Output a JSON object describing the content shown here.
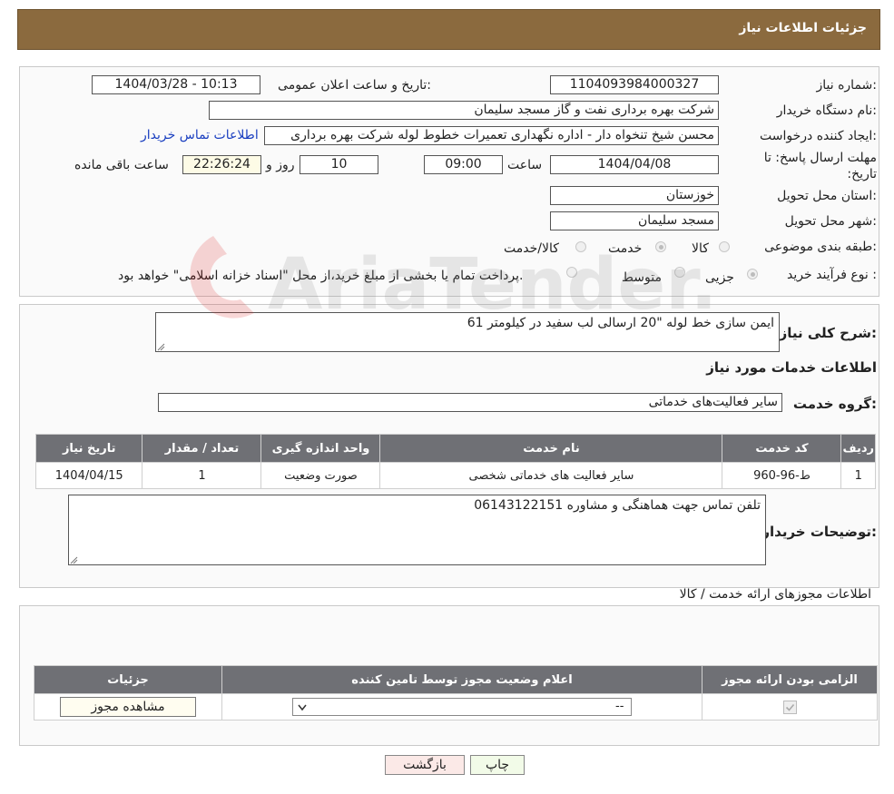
{
  "header": {
    "title": "جزئیات اطلاعات نیاز"
  },
  "form": {
    "need_number_label": "شماره نیاز:",
    "need_number": "1104093984000327",
    "announce_label": "تاریخ و ساعت اعلان عمومی:",
    "announce_value": "1404/03/28 - 10:13",
    "buyer_org_label": "نام دستگاه خریدار:",
    "buyer_org": "شرکت بهره برداری نفت و گاز مسجد سلیمان",
    "creator_label": "ایجاد کننده درخواست:",
    "creator": "محسن شیخ تنخواه دار - اداره نگهداری تعمیرات خطوط لوله  شرکت بهره برداری",
    "buyer_contact_link": "اطلاعات تماس خریدار",
    "deadline_label": "مهلت ارسال پاسخ: تا تاریخ:",
    "deadline_date": "1404/04/08",
    "time_label": "ساعت",
    "deadline_time": "09:00",
    "days_value": "10",
    "days_label": "روز و",
    "remaining_time": "22:26:24",
    "remaining_label": "ساعت باقی مانده",
    "province_label": "استان محل تحویل:",
    "province": "خوزستان",
    "city_label": "شهر محل تحویل:",
    "city": "مسجد سلیمان",
    "category_label": "طبقه بندی موضوعی:",
    "category_options": [
      "کالا",
      "خدمت",
      "کالا/خدمت"
    ],
    "category_selected": "خدمت",
    "process_label": "نوع فرآیند خرید :",
    "process_options": [
      "جزیی",
      "متوسط"
    ],
    "process_note": "پرداخت تمام یا بخشی از مبلغ خرید،از محل \"اسناد خزانه اسلامی\" خواهد بود."
  },
  "summary": {
    "label": "شرح کلی نیاز:",
    "value": "ایمن سازی خط لوله \"20 ارسالی لب سفید در کیلومتر 61",
    "services_title": "اطلاعات خدمات مورد نیاز",
    "service_group_label": "گروه خدمت:",
    "service_group": "سایر فعالیت‌های خدماتی"
  },
  "services_table": {
    "headers": [
      "ردیف",
      "کد خدمت",
      "نام خدمت",
      "واحد اندازه گیری",
      "تعداد / مقدار",
      "تاریخ نیاز"
    ],
    "rows": [
      [
        "1",
        "ط-96-960",
        "سایر فعالیت های خدماتی شخصی",
        "صورت وضعیت",
        "1",
        "1404/04/15"
      ]
    ]
  },
  "buyer_notes": {
    "label": "توضیحات خریدار:",
    "value": "تلفن تماس جهت هماهنگی و مشاوره 06143122151"
  },
  "permits": {
    "title": "اطلاعات مجوزهای ارائه خدمت / کالا",
    "headers": [
      "الزامی بودن ارائه مجوز",
      "اعلام وضعیت مجوز توسط تامین کننده",
      "جزئیات"
    ],
    "select_value": "--",
    "view_button": "مشاهده مجوز"
  },
  "actions": {
    "print": "چاپ",
    "back": "بازگشت"
  },
  "watermark": "AriaTender.net"
}
